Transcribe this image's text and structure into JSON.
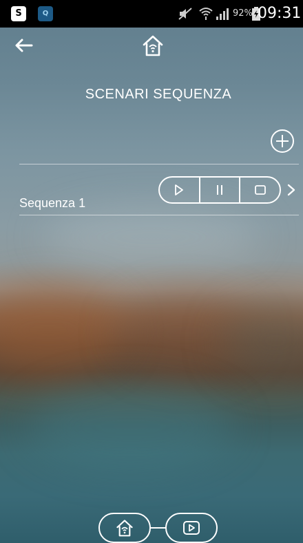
{
  "status_bar": {
    "app_icon_1": "S",
    "app_icon_2": "Q",
    "battery_percent": "92%",
    "time": "09:31"
  },
  "header": {
    "title": "SCENARI SEQUENZA"
  },
  "sequences": [
    {
      "label": "Sequenza 1"
    }
  ],
  "icons": {
    "back": "back-arrow-icon",
    "home": "wifi-home-icon",
    "add": "plus-circle-icon",
    "play": "play-icon",
    "pause": "pause-icon",
    "stop": "stop-icon",
    "chevron": "chevron-right-icon"
  },
  "colors": {
    "status_bar_bg": "#000000",
    "foreground": "#ffffff"
  }
}
